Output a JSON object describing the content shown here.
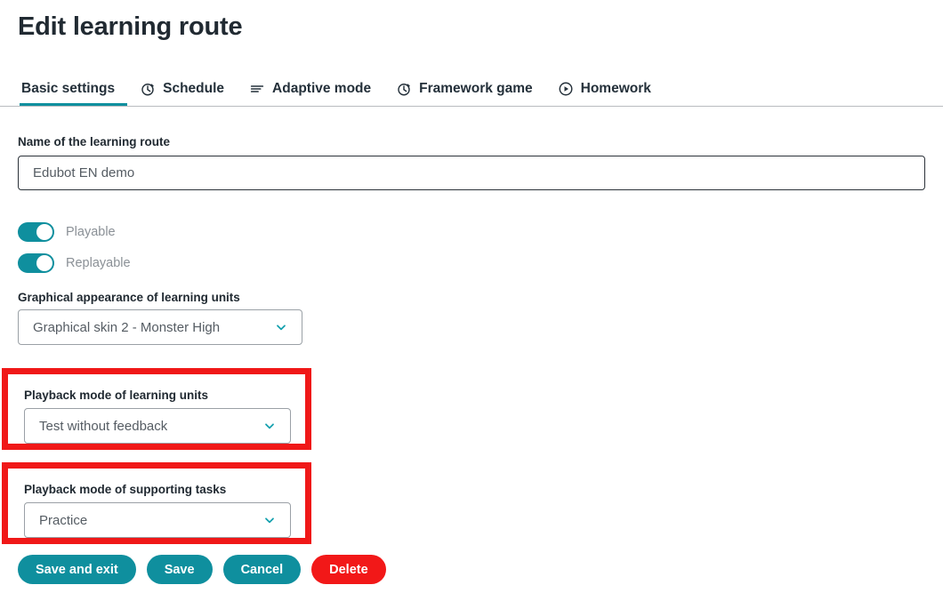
{
  "header": {
    "title": "Edit learning route"
  },
  "tabs": [
    {
      "label": "Basic settings",
      "icon": "none",
      "active": true
    },
    {
      "label": "Schedule",
      "icon": "stopwatch-icon",
      "active": false
    },
    {
      "label": "Adaptive mode",
      "icon": "sort-lines-icon",
      "active": false
    },
    {
      "label": "Framework game",
      "icon": "stopwatch-icon",
      "active": false
    },
    {
      "label": "Homework",
      "icon": "play-circle-icon",
      "active": false
    }
  ],
  "form": {
    "name_label": "Name of the learning route",
    "name_value": "Edubot EN demo",
    "name_placeholder": "Edubot EN demo",
    "toggles": [
      {
        "label": "Playable",
        "on": true
      },
      {
        "label": "Replayable",
        "on": true
      }
    ],
    "skin": {
      "label": "Graphical appearance of learning units",
      "value": "Graphical skin 2 - Monster High"
    },
    "playback_units": {
      "label": "Playback mode of learning units",
      "value": "Test without feedback",
      "highlighted": true
    },
    "playback_supporting": {
      "label": "Playback mode of supporting tasks",
      "value": "Practice",
      "highlighted": true
    }
  },
  "buttons": [
    {
      "label": "Save and exit",
      "style": "primary"
    },
    {
      "label": "Save",
      "style": "primary"
    },
    {
      "label": "Cancel",
      "style": "primary"
    },
    {
      "label": "Delete",
      "style": "danger"
    }
  ],
  "colors": {
    "accent_teal": "#0f8f9e",
    "danger_red": "#f21818",
    "highlight_red": "#f01818",
    "text_dark": "#212a32",
    "text_muted": "#8a9096"
  }
}
